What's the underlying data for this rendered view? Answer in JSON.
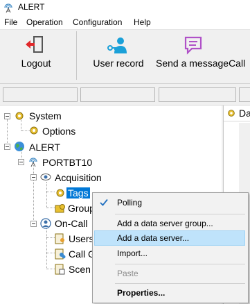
{
  "window": {
    "title": "ALERT"
  },
  "menu": [
    "File",
    "Operation",
    "Configuration",
    "Help"
  ],
  "toolbar": {
    "logout_label": "Logout",
    "user_record_label": "User record",
    "send_message_label": "Send a messageCall"
  },
  "tree": {
    "system": "System",
    "options": "Options",
    "alert": "ALERT",
    "portbt10": "PORTBT10",
    "acquisition": "Acquisition",
    "tags": "Tags",
    "groups": "Group",
    "oncall": "On-Call",
    "users": "Users",
    "callgroups": "Call G",
    "scenarios": "Scen"
  },
  "rightpane": {
    "header": "Da"
  },
  "context_menu": {
    "polling": "Polling",
    "add_group": "Add a data server group...",
    "add_server": "Add a data server...",
    "import": "Import...",
    "paste": "Paste",
    "properties": "Properties..."
  },
  "colors": {
    "selection": "#0078d7",
    "menu_hover": "#bfe3fb",
    "logout_red": "#e0282a",
    "user_cyan": "#1aa0d8",
    "message_purple": "#b051c8"
  }
}
